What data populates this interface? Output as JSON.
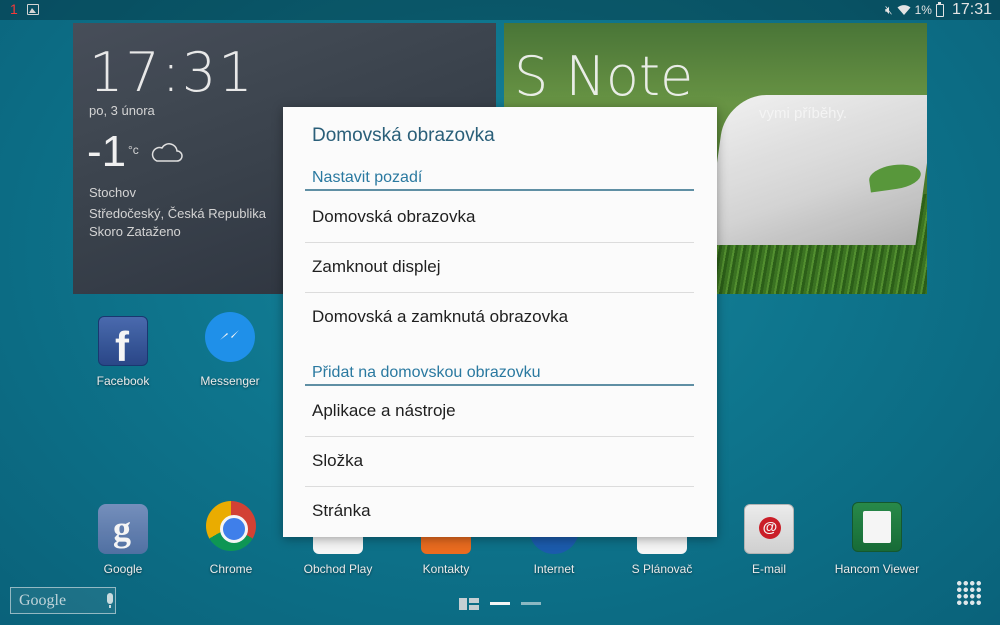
{
  "status_bar": {
    "notification_count": "1",
    "battery_percent": "1%",
    "time": "17:31"
  },
  "weather_widget": {
    "time": "17:31",
    "date": "po, 3 února",
    "temperature": "-1",
    "unit": "°c",
    "city": "Stochov",
    "region": "Středočeský, Česká Republika",
    "condition": "Skoro Zataženo"
  },
  "snote_widget": {
    "title": "S Note",
    "subtitle": "vymi příběhy."
  },
  "apps_top": [
    {
      "label": "Facebook",
      "icon": "facebook-icon"
    },
    {
      "label": "Messenger",
      "icon": "messenger-icon"
    }
  ],
  "dock": [
    {
      "label": "Google",
      "icon": "google-icon"
    },
    {
      "label": "Chrome",
      "icon": "chrome-icon"
    },
    {
      "label": "Obchod Play",
      "icon": "play-store-icon"
    },
    {
      "label": "Kontakty",
      "icon": "contacts-icon"
    },
    {
      "label": "Internet",
      "icon": "internet-icon"
    },
    {
      "label": "S Plánovač",
      "icon": "planner-icon"
    },
    {
      "label": "E-mail",
      "icon": "email-icon"
    },
    {
      "label": "Hancom Viewer",
      "icon": "hancom-icon"
    }
  ],
  "search_bar": {
    "logo": "Google"
  },
  "dialog": {
    "title": "Domovská obrazovka",
    "sections": [
      {
        "header": "Nastavit pozadí",
        "items": [
          "Domovská obrazovka",
          "Zamknout displej",
          "Domovská a zamknutá obrazovka"
        ]
      },
      {
        "header": "Přidat na domovskou obrazovku",
        "items": [
          "Aplikace a nástroje",
          "Složka",
          "Stránka"
        ]
      }
    ]
  },
  "colors": {
    "accent": "#2a79a0",
    "dialog_title": "#2a5f79",
    "background": "#0f7a93"
  }
}
